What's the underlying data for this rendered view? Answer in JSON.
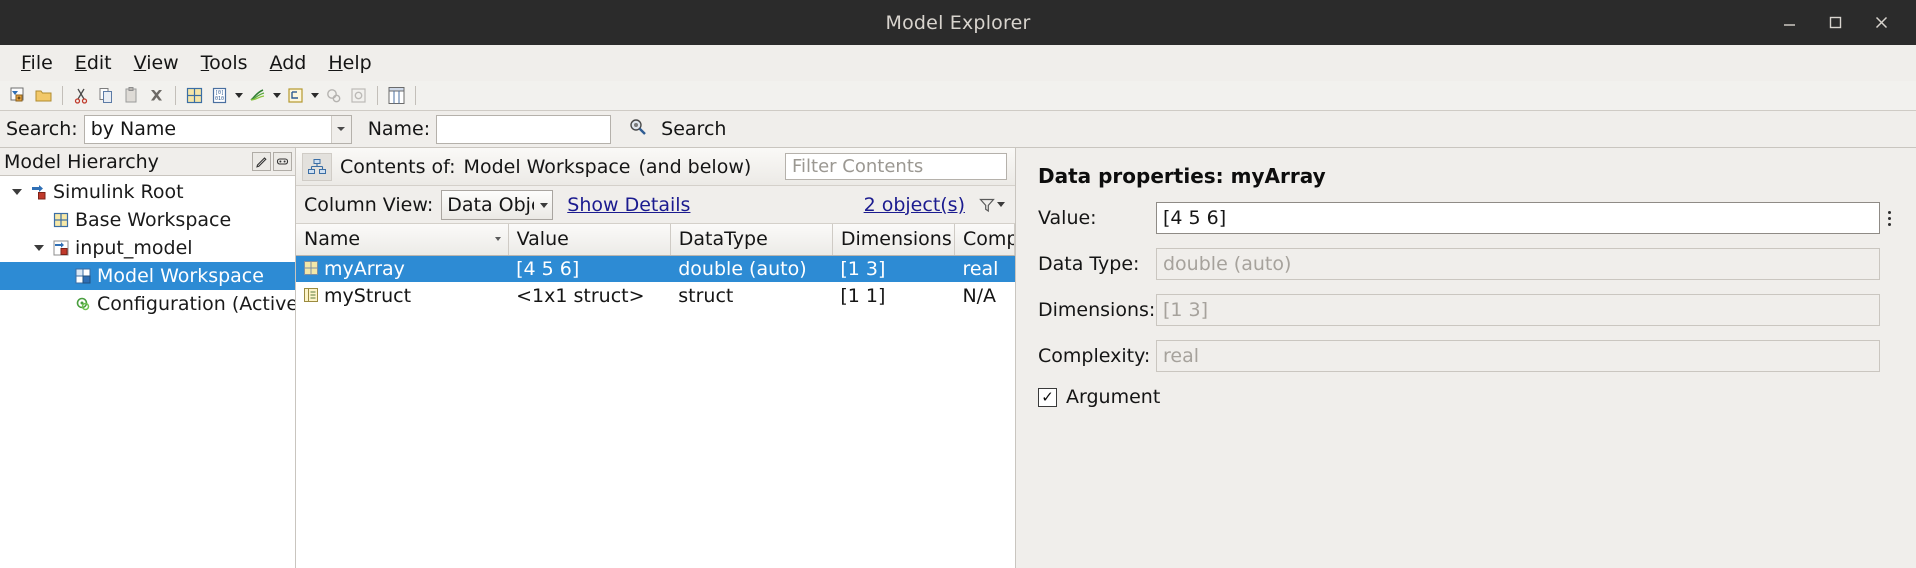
{
  "window": {
    "title": "Model Explorer",
    "minimize_label": "–",
    "maximize_label": "□",
    "close_label": "✕"
  },
  "menubar": {
    "items": [
      {
        "label": "File",
        "mnemonic": "F"
      },
      {
        "label": "Edit",
        "mnemonic": "E"
      },
      {
        "label": "View",
        "mnemonic": "V"
      },
      {
        "label": "Tools",
        "mnemonic": "T"
      },
      {
        "label": "Add",
        "mnemonic": "A"
      },
      {
        "label": "Help",
        "mnemonic": "H"
      }
    ]
  },
  "toolbar": {
    "buttons": [
      {
        "name": "new-model-icon"
      },
      {
        "name": "open-folder-icon"
      },
      {
        "name": "cut-scissors-icon"
      },
      {
        "name": "copy-icon"
      },
      {
        "name": "paste-icon"
      },
      {
        "name": "delete-x-icon"
      },
      {
        "name": "add-parameter-icon"
      },
      {
        "name": "add-data-icon"
      },
      {
        "name": "add-signal-icon"
      },
      {
        "name": "add-bus-icon"
      },
      {
        "name": "configuration-icon"
      },
      {
        "name": "settings-icon"
      },
      {
        "name": "column-view-icon"
      }
    ]
  },
  "search_bar": {
    "search_label": "Search:",
    "search_by_value": "by Name",
    "name_label": "Name:",
    "name_value": "",
    "name_placeholder": "",
    "search_button_label": "Search"
  },
  "hierarchy": {
    "panel_title": "Model Hierarchy",
    "nodes": [
      {
        "label": "Simulink Root",
        "depth": 0,
        "expanded": true,
        "selected": false,
        "icon": "simulink-root-icon"
      },
      {
        "label": "Base Workspace",
        "depth": 1,
        "expanded": null,
        "selected": false,
        "icon": "workspace-grid-icon"
      },
      {
        "label": "input_model",
        "depth": 1,
        "expanded": true,
        "selected": false,
        "icon": "model-icon"
      },
      {
        "label": "Model Workspace",
        "depth": 2,
        "expanded": null,
        "selected": true,
        "icon": "model-workspace-icon"
      },
      {
        "label": "Configuration (Active)",
        "depth": 2,
        "expanded": null,
        "selected": false,
        "icon": "configuration-gear-icon"
      }
    ]
  },
  "contents": {
    "header_prefix": "Contents of:",
    "header_target": "Model Workspace",
    "header_suffix": "(and below)",
    "filter_placeholder": "Filter Contents",
    "column_view_label": "Column View:",
    "column_view_value": "Data Objects",
    "show_details_label": "Show Details",
    "object_count_label": "2 object(s)",
    "columns": [
      "Name",
      "Value",
      "DataType",
      "Dimensions",
      "Complexity"
    ],
    "sorted_column": "Name",
    "rows": [
      {
        "selected": true,
        "icon": "array-object-icon",
        "Name": "myArray",
        "Value": "[4 5 6]",
        "DataType": "double (auto)",
        "Dimensions": "[1 3]",
        "Complexity": "real",
        "dim_cells": []
      },
      {
        "selected": false,
        "icon": "struct-object-icon",
        "Name": "myStruct",
        "Value": "<1x1 struct>",
        "DataType": "struct",
        "Dimensions": "[1 1]",
        "Complexity": "N/A",
        "dim_cells": [
          "DataType",
          "Dimensions",
          "Complexity"
        ]
      }
    ]
  },
  "properties": {
    "title": "Data properties: myArray",
    "fields": [
      {
        "label": "Value:",
        "value": "[4 5 6]",
        "readonly": false,
        "spinner": true
      },
      {
        "label": "Data Type:",
        "value": "double (auto)",
        "readonly": true,
        "spinner": false
      },
      {
        "label": "Dimensions:",
        "value": "[1 3]",
        "readonly": true,
        "spinner": false
      },
      {
        "label": "Complexity:",
        "value": "real",
        "readonly": true,
        "spinner": false
      }
    ],
    "checkbox": {
      "label": "Argument",
      "checked": true,
      "mark": "✓"
    }
  },
  "colors": {
    "selection_blue": "#2d8bd4",
    "titlebar": "#2b2b2b",
    "chrome": "#f0eeeb",
    "link": "#1b1b8f",
    "disabled_text": "#9a968f"
  }
}
